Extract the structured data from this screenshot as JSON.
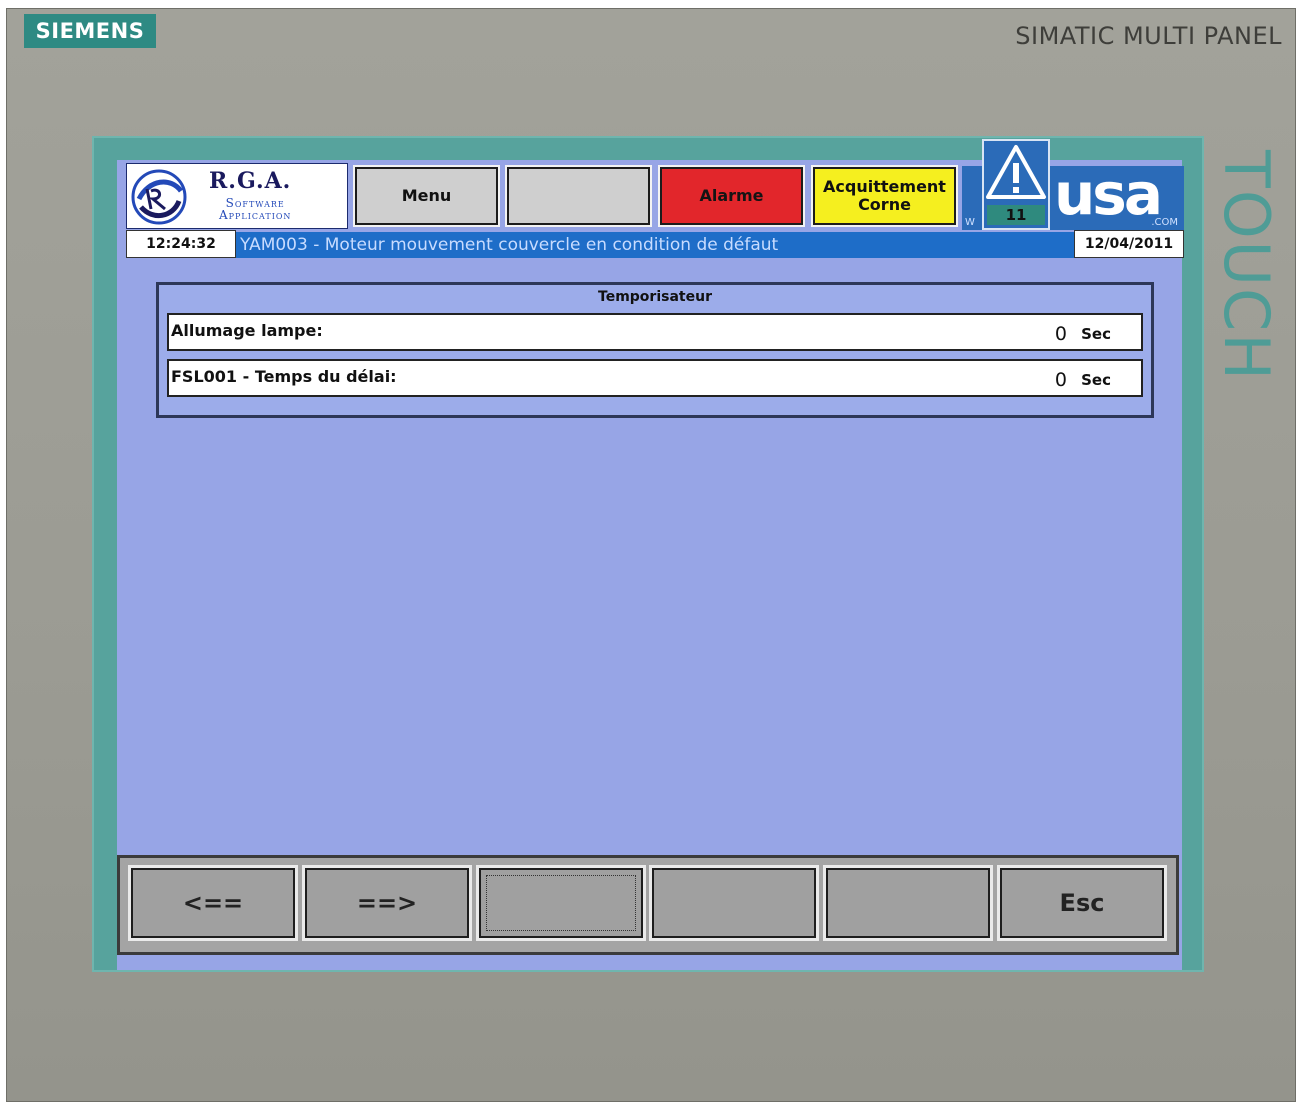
{
  "device": {
    "brand": "SIEMENS",
    "model": "SIMATIC MULTI PANEL",
    "side_label": "TOUCH"
  },
  "header": {
    "company_name": "R.G.A.",
    "company_sub_1": "Software",
    "company_sub_2": "Application",
    "menu_label": "Menu",
    "blank_label": "",
    "alarm_label": "Alarme",
    "ack_label_1": "Acquittement",
    "ack_label_2": "Corne",
    "usa_logo": "usa",
    "usa_com": ".COM",
    "usa_w": "W",
    "warning_count": "11"
  },
  "status": {
    "time": "12:24:32",
    "date": "12/04/2011",
    "alarm_message": "YAM003 - Moteur mouvement couvercle en condition de défaut"
  },
  "panel": {
    "title": "Temporisateur",
    "rows": [
      {
        "label": "Allumage lampe:",
        "value": "0",
        "unit": "Sec"
      },
      {
        "label": "FSL001 - Temps du délai:",
        "value": "0",
        "unit": "Sec"
      }
    ]
  },
  "toolbar": {
    "prev_label": "<==",
    "next_label": "==>",
    "f3_label": "",
    "f4_label": "",
    "f5_label": "",
    "esc_label": "Esc"
  },
  "colors": {
    "screen_bg": "#97a5e6",
    "alarm_button": "#e2262b",
    "ack_button": "#f5ef1f",
    "alarm_line": "#1e6dc8",
    "bezel_accent": "#2e8a83"
  }
}
